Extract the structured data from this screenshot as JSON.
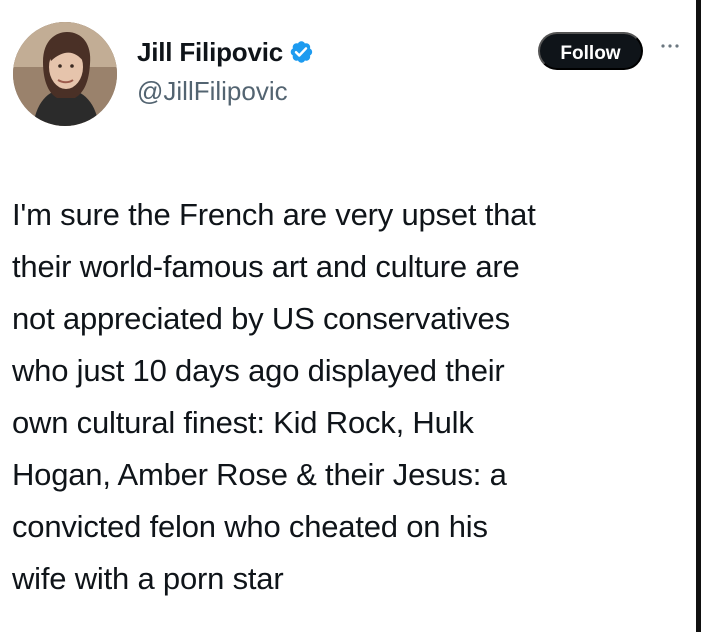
{
  "author": {
    "display_name": "Jill Filipovic",
    "handle": "@JillFilipovic",
    "verified": true,
    "avatar_icon": "profile-photo"
  },
  "actions": {
    "follow_label": "Follow",
    "more_icon": "more-options-icon"
  },
  "tweet": {
    "lines": [
      "I'm sure the French are very upset that",
      "their world-famous art and culture are",
      "not appreciated by US conservatives",
      "who just 10 days ago displayed their",
      "own cultural finest: Kid Rock, Hulk",
      "Hogan, Amber Rose & their Jesus: a",
      "convicted felon who cheated on his",
      "wife with a porn star"
    ]
  },
  "colors": {
    "text": "#0f1419",
    "secondary": "#536471",
    "verified_blue": "#1d9bf0",
    "follow_bg": "#0f1419"
  }
}
